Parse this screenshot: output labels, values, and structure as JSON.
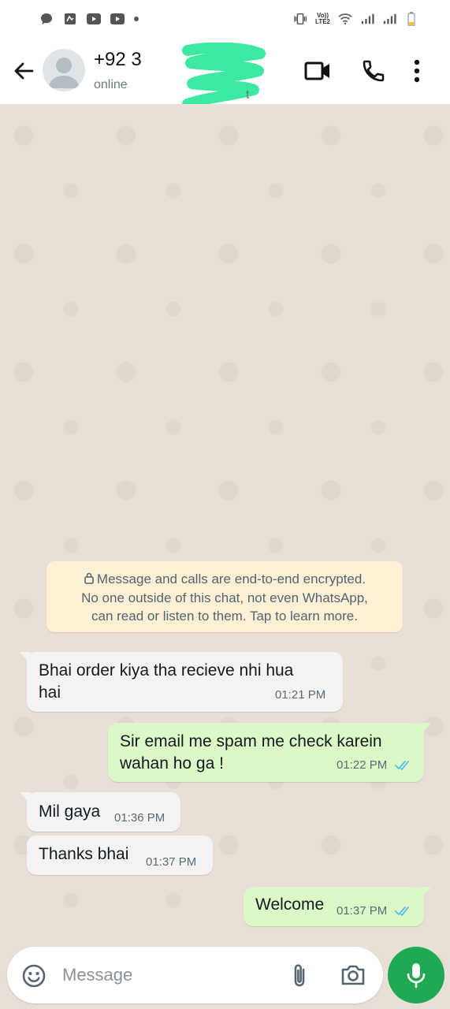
{
  "status_bar": {
    "network_labels": [
      "Vo))",
      "LTE2"
    ]
  },
  "header": {
    "contact_name": "+92 3",
    "contact_status": "online",
    "redaction_trailing_char": "t"
  },
  "chat": {
    "encryption_notice": {
      "lines": [
        "Message and calls are end-to-end encrypted.",
        "No one outside of this chat, not even WhatsApp,",
        "can read or listen to them. Tap to learn more."
      ]
    },
    "messages": [
      {
        "direction": "incoming",
        "lines": [
          "Bhai order kiya tha recieve nhi hua",
          "hai"
        ],
        "time": "01:21 PM"
      },
      {
        "direction": "outgoing",
        "lines": [
          "Sir email me spam me check karein",
          "wahan ho ga !"
        ],
        "time": "01:22 PM",
        "status": "read"
      },
      {
        "direction": "incoming",
        "lines": [
          "Mil gaya"
        ],
        "time": "01:36 PM"
      },
      {
        "direction": "incoming",
        "lines": [
          "Thanks bhai"
        ],
        "time": "01:37 PM"
      },
      {
        "direction": "outgoing",
        "lines": [
          "Welcome"
        ],
        "time": "01:37 PM",
        "status": "read"
      }
    ]
  },
  "input_bar": {
    "placeholder": "Message"
  },
  "icons": [
    "back-arrow-icon",
    "avatar-placeholder",
    "video-call-icon",
    "phone-icon",
    "more-options-icon",
    "lock-icon",
    "double-check-icon",
    "emoji-icon",
    "attach-icon",
    "camera-icon",
    "mic-icon"
  ],
  "colors": {
    "header_bg": "#ffffff",
    "chat_bg": "#e8e0d6",
    "incoming_bubble": "#f3f3f3",
    "outgoing_bubble": "#dcf8c6",
    "notice_bg": "#fdf0d5",
    "read_ticks": "#53bdeb",
    "mic_button": "#1ea952",
    "redaction_mark": "#3de8a0"
  }
}
